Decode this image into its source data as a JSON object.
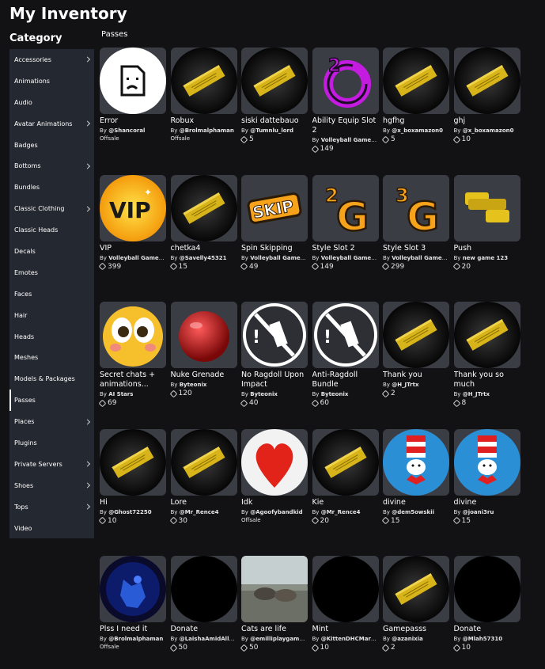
{
  "page": {
    "title": "My Inventory",
    "category_label": "Category",
    "section_label": "Passes"
  },
  "sidebar": {
    "items": [
      {
        "label": "Accessories",
        "chevron": true
      },
      {
        "label": "Animations",
        "chevron": false
      },
      {
        "label": "Audio",
        "chevron": false
      },
      {
        "label": "Avatar Animations",
        "chevron": true
      },
      {
        "label": "Badges",
        "chevron": false
      },
      {
        "label": "Bottoms",
        "chevron": true
      },
      {
        "label": "Bundles",
        "chevron": false
      },
      {
        "label": "Classic Clothing",
        "chevron": true
      },
      {
        "label": "Classic Heads",
        "chevron": false
      },
      {
        "label": "Decals",
        "chevron": false
      },
      {
        "label": "Emotes",
        "chevron": false
      },
      {
        "label": "Faces",
        "chevron": false
      },
      {
        "label": "Hair",
        "chevron": false
      },
      {
        "label": "Heads",
        "chevron": false
      },
      {
        "label": "Meshes",
        "chevron": false
      },
      {
        "label": "Models & Packages",
        "chevron": false
      },
      {
        "label": "Passes",
        "chevron": false,
        "active": true
      },
      {
        "label": "Places",
        "chevron": true
      },
      {
        "label": "Plugins",
        "chevron": false
      },
      {
        "label": "Private Servers",
        "chevron": true
      },
      {
        "label": "Shoes",
        "chevron": true
      },
      {
        "label": "Tops",
        "chevron": true
      },
      {
        "label": "Video",
        "chevron": false
      }
    ]
  },
  "items": [
    {
      "name": "Error",
      "by": "By",
      "creator": "@Shancoral",
      "price": "Offsale",
      "thumb": "error-icon"
    },
    {
      "name": "Robux",
      "by": "By",
      "creator": "@Brolmalphaman",
      "price": "Offsale",
      "thumb": "ticket-icon"
    },
    {
      "name": "siski dattebauo",
      "by": "By",
      "creator": "@Tumnlu_lord",
      "price": "5",
      "thumb": "ticket-icon"
    },
    {
      "name": "Ability Equip Slot 2",
      "by": "By",
      "creator": "Volleyball Game ...",
      "price": "149",
      "thumb": "ability-slot-icon"
    },
    {
      "name": "hgfhg",
      "by": "By",
      "creator": "@x_boxamazon0",
      "price": "5",
      "thumb": "ticket-icon"
    },
    {
      "name": "ghj",
      "by": "By",
      "creator": "@x_boxamazon0",
      "price": "10",
      "thumb": "ticket-icon"
    },
    {
      "name": "VIP",
      "by": "By",
      "creator": "Volleyball Game ...",
      "price": "399",
      "thumb": "vip-icon"
    },
    {
      "name": "chetka4",
      "by": "By",
      "creator": "@Savelly45321",
      "price": "15",
      "thumb": "ticket-icon"
    },
    {
      "name": "Spin Skipping",
      "by": "By",
      "creator": "Volleyball Game ...",
      "price": "49",
      "thumb": "skip-icon"
    },
    {
      "name": "Style Slot 2",
      "by": "By",
      "creator": "Volleyball Game ...",
      "price": "149",
      "thumb": "style-slot-2-icon"
    },
    {
      "name": "Style Slot 3",
      "by": "By",
      "creator": "Volleyball Game ...",
      "price": "299",
      "thumb": "style-slot-3-icon"
    },
    {
      "name": "Push",
      "by": "By",
      "creator": "new game 123",
      "price": "20",
      "thumb": "push-icon"
    },
    {
      "name": "Secret chats + animations...",
      "by": "By",
      "creator": "AI Stars",
      "price": "69",
      "thumb": "emoji-face-icon"
    },
    {
      "name": "Nuke Grenade",
      "by": "By",
      "creator": "Byteonix",
      "price": "120",
      "thumb": "red-ball-icon"
    },
    {
      "name": "No Ragdoll Upon Impact",
      "by": "By",
      "creator": "Byteonix",
      "price": "40",
      "thumb": "no-ragdoll-icon"
    },
    {
      "name": "Anti-Ragdoll Bundle",
      "by": "By",
      "creator": "Byteonix",
      "price": "60",
      "thumb": "no-ragdoll-icon"
    },
    {
      "name": "Thank you",
      "by": "By",
      "creator": "@H_JTrtx",
      "price": "2",
      "thumb": "ticket-icon"
    },
    {
      "name": "Thank you so much",
      "by": "By",
      "creator": "@H_JTrtx",
      "price": "8",
      "thumb": "ticket-icon"
    },
    {
      "name": "Hi",
      "by": "By",
      "creator": "@Ghost72250",
      "price": "10",
      "thumb": "ticket-icon"
    },
    {
      "name": "Lore",
      "by": "By",
      "creator": "@Mr_Rence4",
      "price": "30",
      "thumb": "ticket-icon"
    },
    {
      "name": "Idk",
      "by": "By",
      "creator": "@Agoofybandkid",
      "price": "Offsale",
      "thumb": "heart-ball-icon"
    },
    {
      "name": "Kie",
      "by": "By",
      "creator": "@Mr_Rence4",
      "price": "20",
      "thumb": "ticket-icon"
    },
    {
      "name": "divine",
      "by": "By",
      "creator": "@dem5owskii",
      "price": "15",
      "thumb": "cat-hat-icon"
    },
    {
      "name": "divine",
      "by": "By",
      "creator": "@joani3ru",
      "price": "15",
      "thumb": "cat-hat-icon"
    },
    {
      "name": "Plss I need it",
      "by": "By",
      "creator": "@Brolmalphaman",
      "price": "Offsale",
      "thumb": "blue-photo-icon"
    },
    {
      "name": "Donate",
      "by": "By",
      "creator": "@LaishaAmidAllH...",
      "price": "50",
      "thumb": "black-circle-icon"
    },
    {
      "name": "Cats are life",
      "by": "By",
      "creator": "@emilliplaygamxs...",
      "price": "50",
      "thumb": "cats-photo-icon"
    },
    {
      "name": "Mint",
      "by": "By",
      "creator": "@KittenDHCMark...",
      "price": "10",
      "thumb": "black-circle-icon"
    },
    {
      "name": "Gamepasss",
      "by": "By",
      "creator": "@azanixia",
      "price": "2",
      "thumb": "ticket-icon"
    },
    {
      "name": "Donate",
      "by": "By",
      "creator": "@Mlah57310",
      "price": "10",
      "thumb": "black-circle-icon"
    }
  ],
  "colors": {
    "background": "#121215",
    "sidebar": "#242830",
    "card_thumb": "#3b3d44",
    "ticket": "#d7b51a"
  }
}
